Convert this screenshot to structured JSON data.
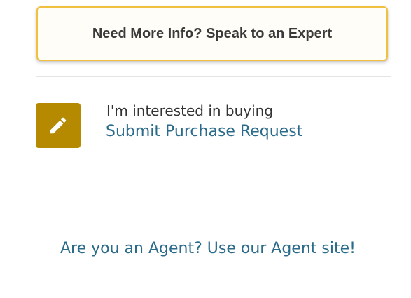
{
  "expert_cta": {
    "label": "Need More Info? Speak to an Expert"
  },
  "purchase": {
    "icon": "pencil-icon",
    "intro": "I'm interested in buying",
    "link": "Submit Purchase Request"
  },
  "agent": {
    "link": "Are you an Agent? Use our Agent site!"
  },
  "colors": {
    "accent_border": "#f0c040",
    "icon_tile": "#b58a00",
    "link": "#2a6a8a"
  }
}
